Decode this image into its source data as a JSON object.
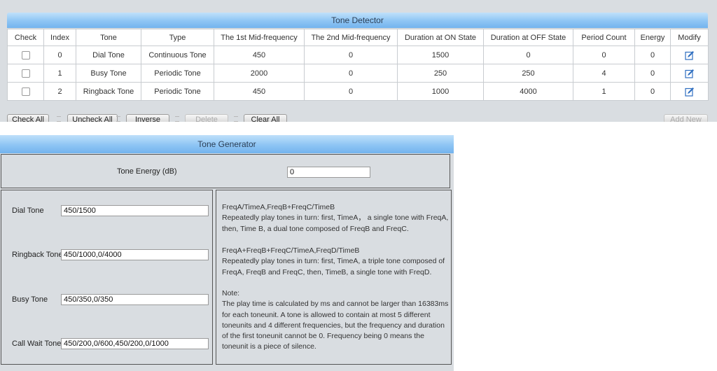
{
  "tone_detector": {
    "title": "Tone Detector",
    "columns": [
      "Check",
      "Index",
      "Tone",
      "Type",
      "The 1st Mid-frequency",
      "The 2nd Mid-frequency",
      "Duration at ON State",
      "Duration at OFF State",
      "Period Count",
      "Energy",
      "Modify"
    ],
    "rows": [
      {
        "index": "0",
        "tone": "Dial Tone",
        "type": "Continuous Tone",
        "mid1": "450",
        "mid2": "0",
        "on": "1500",
        "off": "0",
        "period": "0",
        "energy": "0"
      },
      {
        "index": "1",
        "tone": "Busy Tone",
        "type": "Periodic Tone",
        "mid1": "2000",
        "mid2": "0",
        "on": "250",
        "off": "250",
        "period": "4",
        "energy": "0"
      },
      {
        "index": "2",
        "tone": "Ringback Tone",
        "type": "Periodic Tone",
        "mid1": "450",
        "mid2": "0",
        "on": "1000",
        "off": "4000",
        "period": "1",
        "energy": "0"
      }
    ],
    "buttons": {
      "check_all": "Check All",
      "uncheck_all": "Uncheck All",
      "inverse": "Inverse",
      "delete": "Delete",
      "clear_all": "Clear All",
      "add_new": "Add New"
    }
  },
  "tone_generator": {
    "title": "Tone Generator",
    "energy_label": "Tone Energy (dB)",
    "energy_value": "0",
    "fields": {
      "dial_label": "Dial Tone",
      "dial_value": "450/1500",
      "ringback_label": "Ringback Tone",
      "ringback_value": "450/1000,0/4000",
      "busy_label": "Busy Tone",
      "busy_value": "450/350,0/350",
      "callwait_label": "Call Wait Tone",
      "callwait_value": "450/200,0/600,450/200,0/1000"
    },
    "help": {
      "format1": "FreqA/TimeA,FreqB+FreqC/TimeB",
      "desc1": "Repeatedly play tones in turn: first, TimeA， a single tone with FreqA, then, Time B, a dual tone composed of FreqB and FreqC.",
      "format2": "FreqA+FreqB+FreqC/TimeA,FreqD/TimeB",
      "desc2": "Repeatedly play tones in turn: first, TimeA, a triple tone composed of FreqA, FreqB and FreqC, then, TimeB, a single tone with FreqD.",
      "note_title": "Note:",
      "note_text": "The play time is calculated by ms and cannot be larger than 16383ms for each toneunit. A tone is allowed to contain at most 5 different toneunits and 4 different frequencies, but the frequency and duration of the first toneunit cannot be 0. Frequency being 0 means the toneunit is a piece of silence."
    }
  }
}
